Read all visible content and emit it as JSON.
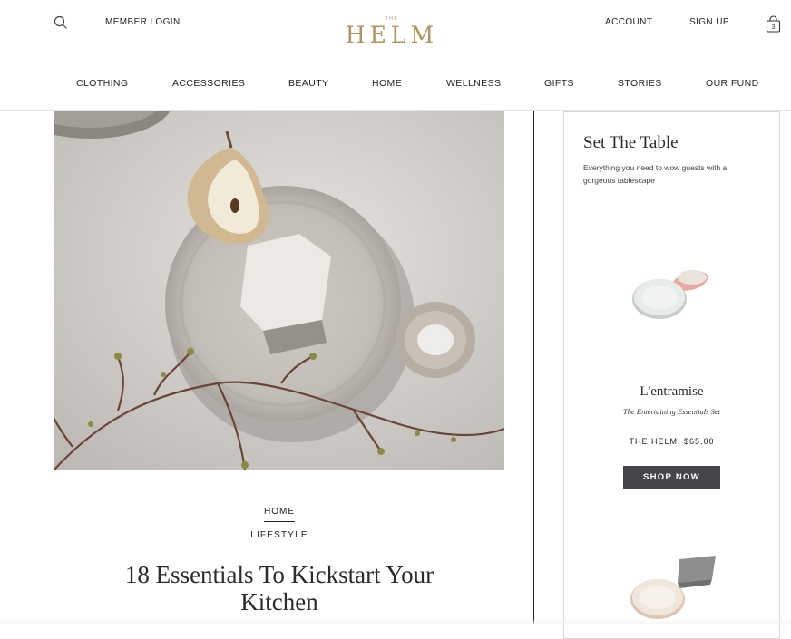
{
  "header": {
    "member_login": "MEMBER LOGIN",
    "logo_small": "THE",
    "logo_word": "HELM",
    "account": "ACCOUNT",
    "sign_up": "SIGN UP",
    "cart_count": "3"
  },
  "nav": {
    "items": [
      "CLOTHING",
      "ACCESSORIES",
      "BEAUTY",
      "HOME",
      "WELLNESS",
      "GIFTS",
      "STORIES",
      "OUR FUND"
    ]
  },
  "article": {
    "category": "HOME",
    "subcategory": "LIFESTYLE",
    "title": "18 Essentials To Kickstart Your Kitchen"
  },
  "sidebar": {
    "title": "Set The Table",
    "subtitle": "Everything you need to wow guests with a gorgeous tablescape",
    "product": {
      "name": "L'entramise",
      "tagline": "The Entertaining Essentials Set",
      "price": "THE HELM, $65.00",
      "cta": "SHOP NOW"
    }
  },
  "colors": {
    "brand_gold": "#b1935e",
    "button_bg": "#45454a"
  },
  "icons": {
    "search": "search-icon",
    "cart": "shopping-bag-icon"
  }
}
